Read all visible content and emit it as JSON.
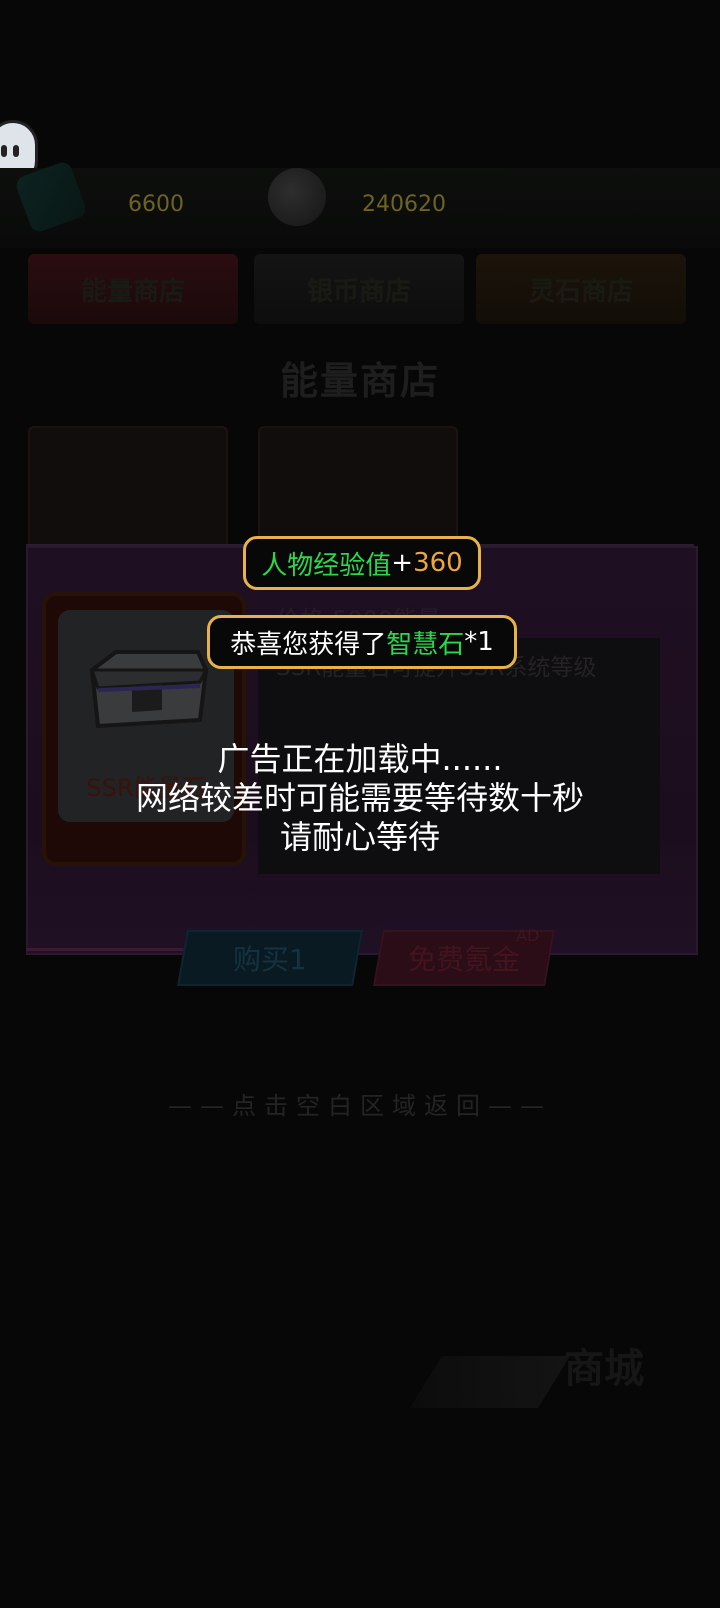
{
  "resources": {
    "energy_value": "6600",
    "silver_value": "240620"
  },
  "tabs": [
    "能量商店",
    "银币商店",
    "灵石商店"
  ],
  "shop_title": "能量商店",
  "item": {
    "name": "SSR能量石",
    "price": "价格:5000能量",
    "description": "SSR能量石可提升SSR系统等级"
  },
  "buttons": {
    "buy": "购买1",
    "free": "免费氪金",
    "ad_tag": "AD"
  },
  "return_hint": "——点击空白区域返回——",
  "mall_label": "商城",
  "toast_exp": {
    "label": "人物经验值",
    "plus": "+",
    "value": "360"
  },
  "toast_reward": {
    "prefix": "恭喜您获得了",
    "item": "智慧石",
    "suffix": "*1"
  },
  "loading": {
    "line1": "广告正在加载中......",
    "line2": "网络较差时可能需要等待数十秒",
    "line3": "请耐心等待"
  },
  "colors": {
    "toast_border": "#e8b24a",
    "green": "#29d94a",
    "orange": "#f0a53c"
  }
}
